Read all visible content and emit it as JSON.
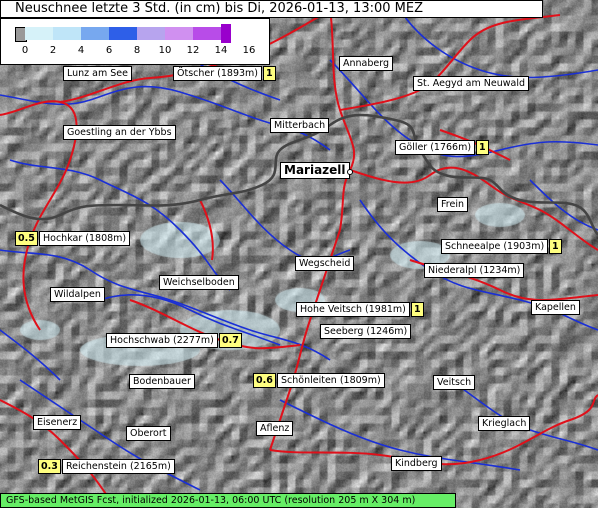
{
  "title": "Neuschnee letzte 3 Std. (in cm) bis Di, 2026-01-13, 13:00 MEZ",
  "legend": {
    "ticks": [
      "0",
      "2",
      "4",
      "6",
      "8",
      "10",
      "12",
      "14",
      "16"
    ],
    "colors": [
      "#999999",
      "#d6f2f9",
      "#bfe5f8",
      "#77a8ef",
      "#2e5fe8",
      "#b7a4ee",
      "#d090f0",
      "#b84ce8",
      "#9900cc"
    ]
  },
  "places": [
    {
      "name": "Lunz am See"
    },
    {
      "name": "Ötscher (1893m)",
      "value": "1"
    },
    {
      "name": "Annaberg"
    },
    {
      "name": "St. Aegyd am Neuwald"
    },
    {
      "name": "Goestling an der Ybbs"
    },
    {
      "name": "Mitterbach"
    },
    {
      "name": "Göller (1766m)",
      "value": "1"
    },
    {
      "name": "Mariazell",
      "bold": true
    },
    {
      "name": "Frein"
    },
    {
      "name": "Hochkar (1808m)",
      "value": "0.5"
    },
    {
      "name": "Schneealpe (1903m)",
      "value": "1"
    },
    {
      "name": "Wegscheid"
    },
    {
      "name": "Niederalpl (1234m)"
    },
    {
      "name": "Weichselboden"
    },
    {
      "name": "Wildalpen"
    },
    {
      "name": "Hohe Veitsch (1981m)",
      "value": "1"
    },
    {
      "name": "Kapellen"
    },
    {
      "name": "Seeberg (1246m)"
    },
    {
      "name": "Hochschwab (2277m)",
      "value": "0.7"
    },
    {
      "name": "Bodenbauer"
    },
    {
      "name": "Schönleiten (1809m)",
      "value": "0.6"
    },
    {
      "name": "Veitsch"
    },
    {
      "name": "Eisenerz"
    },
    {
      "name": "Oberort"
    },
    {
      "name": "Aflenz"
    },
    {
      "name": "Krieglach"
    },
    {
      "name": "Reichenstein (2165m)",
      "value": "0.3"
    },
    {
      "name": "Kindberg"
    }
  ],
  "footer": "GFS-based MetGIS Fcst, initialized 2026-01-13, 06:00 UTC  (resolution 205 m X 304 m)"
}
